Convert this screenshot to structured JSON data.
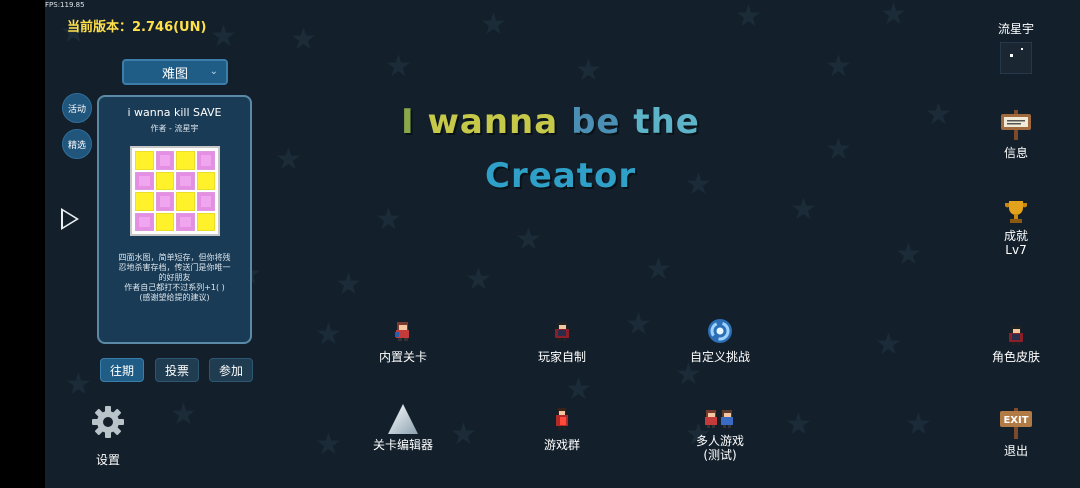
{
  "fps": "FPS:119.85",
  "version": "当前版本：2.746(UN)",
  "difficulty": {
    "label": "难图"
  },
  "side_buttons": {
    "activity": "活动",
    "featured": "精选"
  },
  "level_card": {
    "title": "i wanna kill SAVE",
    "author": "作者 - 流星宇",
    "thumbnail_pattern": [
      [
        "y",
        "p",
        "y",
        "p"
      ],
      [
        "p",
        "y",
        "p",
        "y"
      ],
      [
        "y",
        "p",
        "y",
        "p"
      ],
      [
        "p",
        "y",
        "p",
        "y"
      ]
    ],
    "description_lines": [
      "四面水图，简单短存，但你将残",
      "忍地杀害存档，传送门是你唯一",
      "的好朋友",
      "作者自己都打不过系列+1( )",
      "(感谢望给提的建议)"
    ]
  },
  "tabs": {
    "past": "往期",
    "vote": "投票",
    "join": "参加"
  },
  "game_title": {
    "line1_words": [
      {
        "text": "I",
        "color": "#8aa84a"
      },
      {
        "text": "wanna",
        "color": "#c6c84a"
      },
      {
        "text": "be",
        "color": "#4b8fb5"
      },
      {
        "text": "the",
        "color": "#5db3c8"
      }
    ],
    "line2": {
      "text": "Creator",
      "color": "#2fa0c8"
    }
  },
  "menu": {
    "builtin": "内置关卡",
    "player_made": "玩家自制",
    "custom_challenge": "自定义挑战",
    "editor": "关卡编辑器",
    "group": "游戏群",
    "multiplayer_line1": "多人游戏",
    "multiplayer_line2": "(测试)"
  },
  "right": {
    "username": "流星宇",
    "info": "信息",
    "achievement": "成就",
    "level": "Lv7",
    "skins": "角色皮肤",
    "exit": "退出",
    "exit_sign_text": "EXIT"
  },
  "settings": "设置"
}
